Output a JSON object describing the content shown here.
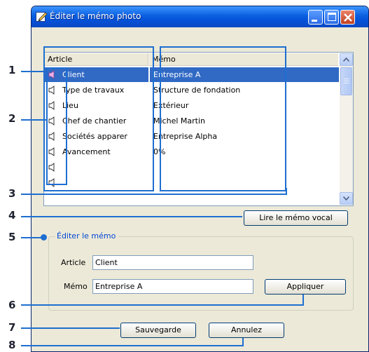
{
  "window": {
    "title": "Éditer le mémo photo"
  },
  "list": {
    "columns": {
      "article": "Article",
      "memo": "Mémo"
    },
    "rows": [
      {
        "article": "Client",
        "memo": "Entreprise A",
        "selected": true
      },
      {
        "article": "Type de travaux",
        "memo": "Structure de fondation",
        "selected": false
      },
      {
        "article": "Lieu",
        "memo": "Extérieur",
        "selected": false
      },
      {
        "article": "Chef de chantier",
        "memo": "Michel Martin",
        "selected": false
      },
      {
        "article": "Sociétés apparer",
        "memo": "Entreprise Alpha",
        "selected": false
      },
      {
        "article": "Avancement",
        "memo": "0%",
        "selected": false
      },
      {
        "article": "",
        "memo": "",
        "selected": false
      }
    ]
  },
  "buttons": {
    "play_voice": "Lire le mémo vocal",
    "apply": "Appliquer",
    "save": "Sauvegarde",
    "cancel": "Annulez"
  },
  "edit": {
    "group_title": "Éditer le mémo",
    "article_label": "Article",
    "article_value": "Client",
    "memo_label": "Mémo",
    "memo_value": "Entreprise A"
  },
  "callouts": [
    "1",
    "2",
    "3",
    "4",
    "5",
    "6",
    "7",
    "8"
  ],
  "colors": {
    "accent": "#1e6fd0",
    "selection": "#316ac5",
    "titlebar": "#0a5fe0"
  }
}
